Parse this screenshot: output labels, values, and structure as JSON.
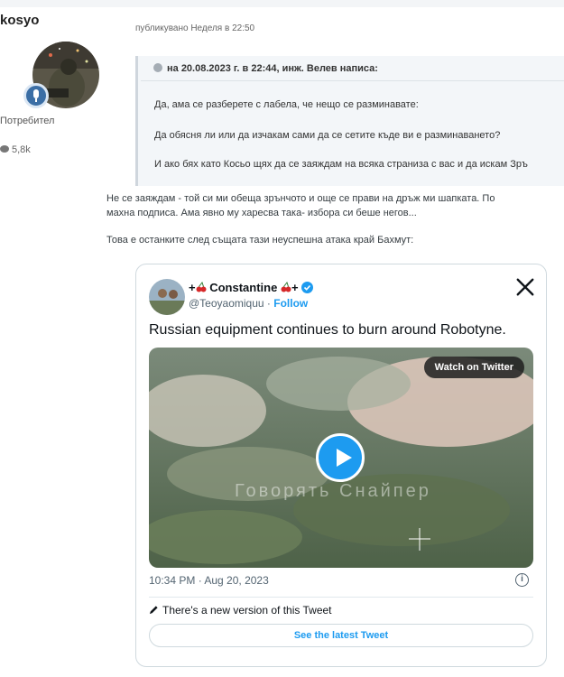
{
  "author": {
    "name": "kosyo",
    "title": "Потребител",
    "posts": "5,8k"
  },
  "post": {
    "meta": "публикувано Неделя в 22:50",
    "quote": {
      "header": "на 20.08.2023 г. в 22:44, инж. Велев написа:",
      "lines": [
        "Да, ама се разберете с лабела, че нещо се разминавате:",
        "Да обясня ли или да изчакам сами да се сетите къде ви е разминаването?",
        "И ако бях като Косьо щях да се заяждам на всяка страниза с вас и да искам Зръ"
      ]
    },
    "paragraphs": [
      "Не се заяждам - той си ми обеща зрънчото и още се прави на дръж ми шапката. По",
      "махна подписа. Ама явно му харесва така- избора си беше негов...",
      "Това е останките след същата тази неуспешна атака край Бахмут:"
    ]
  },
  "tweet": {
    "name": "Constantine",
    "name_prefix": "+",
    "name_suffix": "+",
    "handle": "@Teoyaomiquu",
    "separator": "·",
    "follow": "Follow",
    "text": "Russian equipment continues to burn around Robotyne.",
    "watch_label": "Watch on Twitter",
    "watermark": "Говорять Снайпер",
    "timestamp": "10:34 PM · Aug 20, 2023",
    "new_version": "There's a new version of this Tweet",
    "latest_button": "See the latest Tweet",
    "colors": {
      "accent": "#1d9bf0",
      "text": "#0f1419",
      "muted": "#536471"
    }
  },
  "icons": [
    "speech-bubble-icon",
    "quote-icon",
    "cherry-icon",
    "verified-badge-icon",
    "x-logo-icon",
    "play-icon",
    "info-icon",
    "pen-icon"
  ]
}
